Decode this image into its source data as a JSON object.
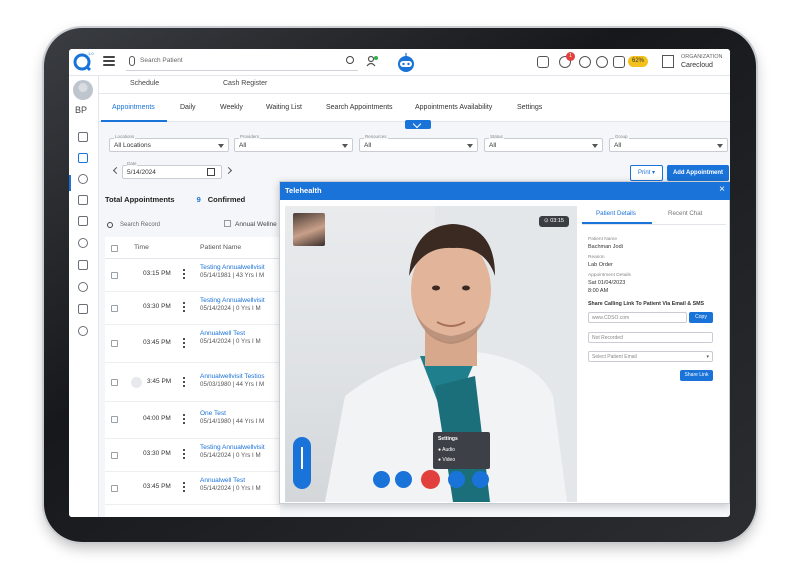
{
  "header": {
    "search_placeholder": "Search Patient",
    "logo_version": "1.0",
    "notification_count": "1",
    "task_percent": "62%",
    "org_label": "ORGANIZATION",
    "org_name": "Carecloud"
  },
  "user": {
    "initials": "BP"
  },
  "subnav": [
    "Schedule",
    "Cash Register"
  ],
  "tabs": [
    "Appointments",
    "Daily",
    "Weekly",
    "Waiting List",
    "Search Appointments",
    "Appointments Availability",
    "Settings"
  ],
  "filters": [
    {
      "label": "Locations",
      "value": "All Locations"
    },
    {
      "label": "Providers",
      "value": "All"
    },
    {
      "label": "Resources",
      "value": "All"
    },
    {
      "label": "Status",
      "value": "All"
    },
    {
      "label": "Group",
      "value": "All"
    }
  ],
  "date": {
    "label": "Date",
    "value": "5/14/2024"
  },
  "actions": {
    "print": "Print",
    "add": "Add Appointment"
  },
  "summary": {
    "total_label": "Total Appointments",
    "total": "9",
    "confirmed_label": "Confirmed"
  },
  "list": {
    "search_placeholder": "Search Record",
    "annual_filter": "Annual Wellne",
    "columns": [
      "Time",
      "Patient Name"
    ],
    "rows": [
      {
        "time": "03:15 PM",
        "name": "Testing Annualwellvisit",
        "info": "05/14/1981 | 43 Yrs I M"
      },
      {
        "time": "03:30 PM",
        "name": "Testing Annualwellvisit",
        "info": "05/14/2024 | 0 Yrs I M"
      },
      {
        "time": "03:45 PM",
        "name": "Annualwell Test",
        "info": "05/14/2024 | 0 Yrs I M"
      },
      {
        "time": "3:45 PM",
        "name": "Annualwellvisit Testios",
        "info": "05/03/1980 | 44 Yrs I M"
      },
      {
        "time": "04:00 PM",
        "name": "One Test",
        "info": "05/14/1980 | 44 Yrs I M"
      },
      {
        "time": "03:30 PM",
        "name": "Testing Annualwellvisit",
        "info": "05/14/2024 | 0 Yrs I M"
      },
      {
        "time": "03:45 PM",
        "name": "Annualwell Test",
        "info": "05/14/2024 | 0 Yrs I M"
      }
    ]
  },
  "telehealth": {
    "title": "Telehealth",
    "timer": "03:15",
    "settings_title": "Settings",
    "settings_items": [
      "Audio",
      "Video"
    ],
    "side_tabs": [
      "Patient Details",
      "Recent Chat"
    ],
    "patient_name_label": "Patient Name",
    "patient_name": "Bachman Jodi",
    "reason_label": "Reason",
    "reason": "Lab Order",
    "appt_label": "Appointment Details",
    "appt_date": "Sat 01/04/2023",
    "appt_time": "8:00 AM",
    "share_title": "Share Calling Link To Patient Via Email & SMS",
    "link_value": "www.CDSO.com",
    "copy": "Copy",
    "not_recorded": "Not Recorded",
    "select_email": "Select Patient Email",
    "share_link": "Share Link"
  },
  "colors": {
    "accent": "#1a73d9",
    "danger": "#e2403d",
    "warning": "#f3c11b"
  }
}
